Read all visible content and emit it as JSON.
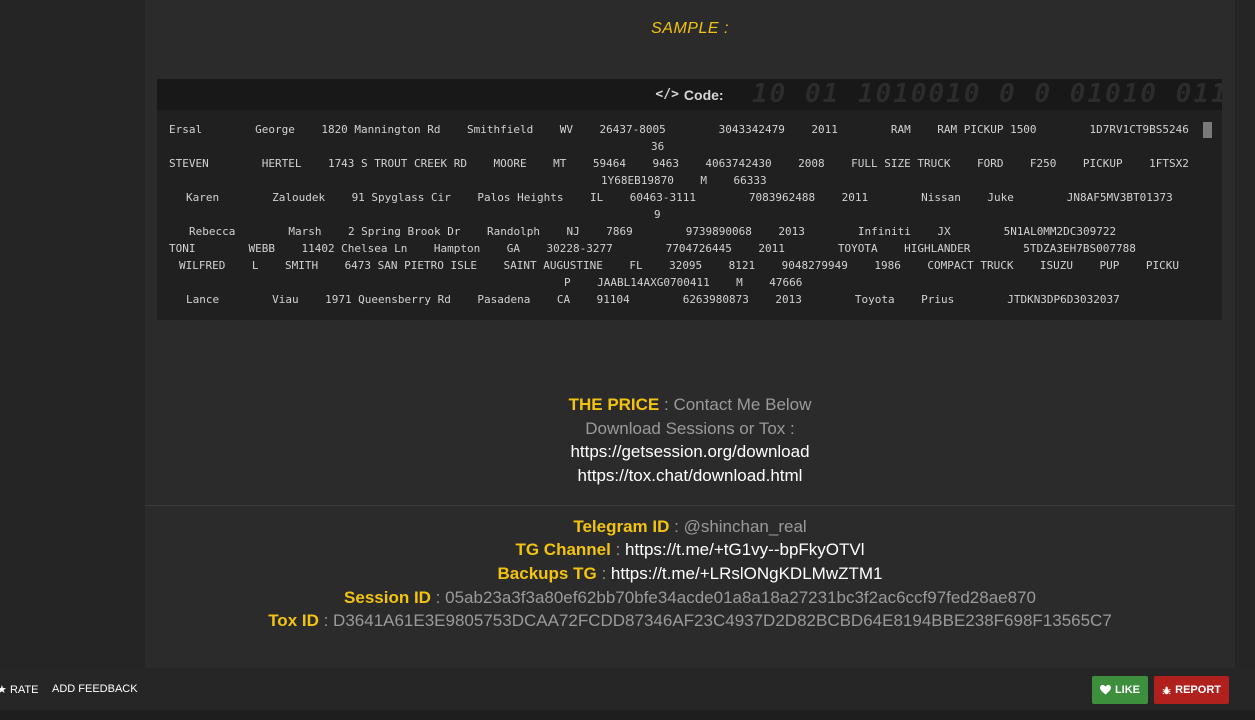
{
  "sample_title": "SAMPLE :",
  "code_block": {
    "title": "Code:",
    "lines": [
      "Ersal        George    1820 Mannington Rd    Smithfield    WV    26437-8005        3043342479    2011        RAM    RAM PICKUP 1500        1D7RV1CT9BS5246",
      "36",
      "STEVEN        HERTEL    1743 S TROUT CREEK RD    MOORE    MT    59464    9463    4063742430    2008    FULL SIZE TRUCK    FORD    F250    PICKUP    1FTSX2",
      "1Y68EB19870    M    66333",
      "Karen        Zaloudek    91 Spyglass Cir    Palos Heights    IL    60463-3111        7083962488    2011        Nissan    Juke        JN8AF5MV3BT01373",
      "9",
      "Rebecca        Marsh    2 Spring Brook Dr    Randolph    NJ    7869        9739890068    2013        Infiniti    JX        5N1AL0MM2DC309722",
      "TONI        WEBB    11402 Chelsea Ln    Hampton    GA    30228-3277        7704726445    2011        TOYOTA    HIGHLANDER        5TDZA3EH7BS007788",
      "WILFRED    L    SMITH    6473 SAN PIETRO ISLE    SAINT AUGUSTINE    FL    32095    8121    9048279949    1986    COMPACT TRUCK    ISUZU    PUP    PICKU",
      "P    JAABL14AXG0700411    M    47666",
      "Lance        Viau    1971 Queensberry Rd    Pasadena    CA    91104        6263980873    2013        Toyota    Prius        JTDKN3DP6D3032037"
    ]
  },
  "price": {
    "label": "THE PRICE",
    "separator": " : ",
    "value": "Contact Me Below",
    "download_text": "Download Sessions or Tox :",
    "link1": "https://getsession.org/download",
    "link2": "https://tox.chat/download.html"
  },
  "contacts": {
    "telegram_label": "Telegram ID",
    "telegram_value": "@shinchan_real",
    "tg_channel_label": "TG Channel",
    "tg_channel_value": "https://t.me/+tG1vy--bpFkyOTVl",
    "backups_label": "Backups TG",
    "backups_value": "https://t.me/+LRslONgKDLMwZTM1",
    "session_label": "Session ID",
    "session_value": "05ab23a3f3a80ef62bb70bfe34acde01a8a18a27231bc3f2ac6ccf97fed28ae870",
    "tox_label": "Tox ID",
    "tox_value": "D3641A61E3E9805753DCAA72FCDD87346AF23C4937D2D82BCBD64E8194BBE238F698F13565C7",
    "separator": " : "
  },
  "footer": {
    "rate_label": "RATE",
    "feedback_label": "ADD FEEDBACK",
    "like_label": "LIKE",
    "report_label": "REPORT"
  },
  "colors": {
    "accent": "#f2c311",
    "like": "#3d8f3d",
    "report": "#b0211d"
  }
}
